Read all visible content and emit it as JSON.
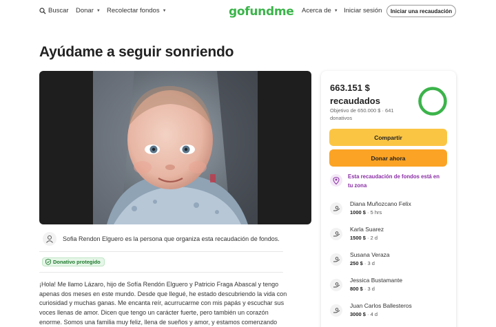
{
  "header": {
    "search_label": "Buscar",
    "donar_label": "Donar",
    "recolectar_label": "Recolectar fondos",
    "logo_text": "gofundme",
    "acerca_label": "Acerca de",
    "login_label": "Iniciar sesión",
    "start_label": "Iniciar una recaudación"
  },
  "campaign": {
    "title": "Ayúdame a seguir sonriendo",
    "organizer_text": "Sofia Rendon Elguero es la persona que organiza esta recaudación de fondos.",
    "protected_badge": "Donativo protegido",
    "story_lines": [
      "¡Hola! Me llamo Lázaro, hijo de Sofía Rendón Elguero y Patricio Fraga Abascal y tengo",
      "apenas dos meses en este mundo. Desde que llegué, he estado descubriendo la vida con",
      "curiosidad y muchas ganas. Me encanta reír, acurrucarme con mis papás y escuchar sus",
      "voces llenas de amor. Dicen que tengo un carácter fuerte, pero también un corazón",
      "enorme. Somos una familia muy feliz, llena de sueños y amor, y estamos comenzando"
    ]
  },
  "sidebar": {
    "raised_amount": "663.151 $",
    "raised_word": "recaudados",
    "goal_text": "Objetivo de 650.000 $ · 641 donativos",
    "progress_fraction": 1.0,
    "share_label": "Compartir",
    "donate_label": "Donar ahora",
    "local_text_line1": "Esta recaudación de fondos está en",
    "local_text_line2": "tu zona",
    "donors": [
      {
        "name": "Diana Muñozcano Felix",
        "amount": "1000 $",
        "time": " · 5 hrs"
      },
      {
        "name": "Karla Suarez",
        "amount": "1500 $",
        "time": " · 2 d"
      },
      {
        "name": "Susana Veraza",
        "amount": "250 $",
        "time": " · 3 d"
      },
      {
        "name": "Jessica Bustamante",
        "amount": "800 $",
        "time": " · 3 d"
      },
      {
        "name": "Juan Carlos Ballesteros",
        "amount": "3000 $",
        "time": " · 4 d"
      }
    ]
  },
  "colors": {
    "brand_green": "#3bb44a",
    "share_yellow": "#fbc544",
    "donate_orange": "#fba324",
    "local_purple": "#8a2da5"
  },
  "icons": [
    "search-icon",
    "chevron-down-icon",
    "user-icon",
    "shield-check-icon",
    "location-pin-icon",
    "donation-hand-icon"
  ]
}
